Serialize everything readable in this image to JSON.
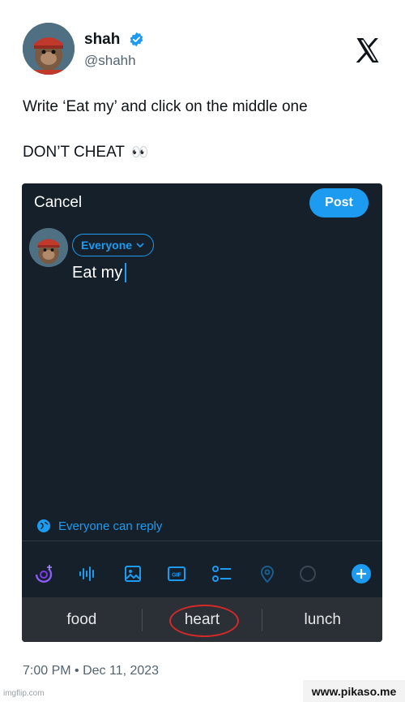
{
  "tweet": {
    "name": "shah",
    "handle": "@shahh",
    "line1": "Write ‘Eat my’ and click on the middle one",
    "line2": "DON’T CHEAT",
    "emoji": "👀",
    "timestamp": "7:00 PM • Dec 11, 2023"
  },
  "composer": {
    "cancel_label": "Cancel",
    "post_label": "Post",
    "audience_label": "Everyone",
    "text": "Eat my",
    "reply_setting": "Everyone can reply"
  },
  "toolbar_icons": [
    "grok-icon",
    "audio-icon",
    "image-icon",
    "gif-icon",
    "poll-icon",
    "location-icon",
    "progress-ring-icon",
    "add-icon"
  ],
  "keyboard_suggestions": [
    "food",
    "heart",
    "lunch"
  ],
  "watermarks": {
    "imgflip": "imgflip.com",
    "pikaso": "www.pikaso.me"
  },
  "colors": {
    "accent": "#1d9bf0",
    "dark_bg": "#15202b",
    "highlight_circle": "#d42a2a"
  }
}
